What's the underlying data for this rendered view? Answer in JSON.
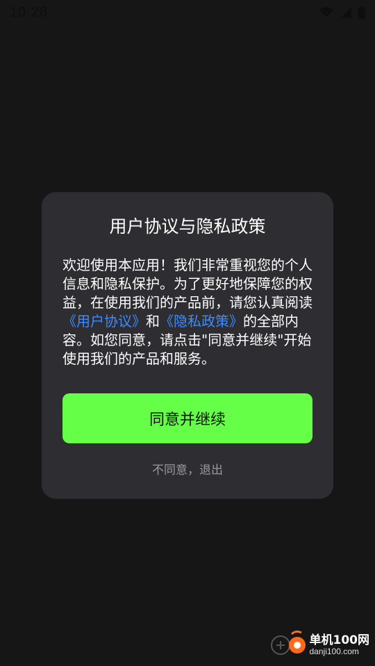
{
  "status_bar": {
    "time": "10:28",
    "icons": [
      "wifi-icon",
      "signal-icon",
      "battery-icon"
    ]
  },
  "dialog": {
    "title": "用户协议与隐私政策",
    "body": {
      "text_1": "欢迎使用本应用！我们非常重视您的个人信息和隐私保护。为了更好地保障您的权益，在使用我们的产品前，请您认真阅读",
      "link_user_agreement": "《用户协议》",
      "text_2": "和",
      "link_privacy_policy": "《隐私政策》",
      "text_3": "的全部内容。如您同意，请点击\"同意并继续\"开始使用我们的产品和服务。"
    },
    "agree_label": "同意并继续",
    "decline_label": "不同意，退出"
  },
  "watermark": {
    "brand": "单机100网",
    "domain": "danji100.com"
  },
  "colors": {
    "background": "#161616",
    "dialog_background": "#2d2d32",
    "accent_button": "#64ff46",
    "link": "#3d8cff",
    "secondary_text": "#9a9a9e"
  }
}
